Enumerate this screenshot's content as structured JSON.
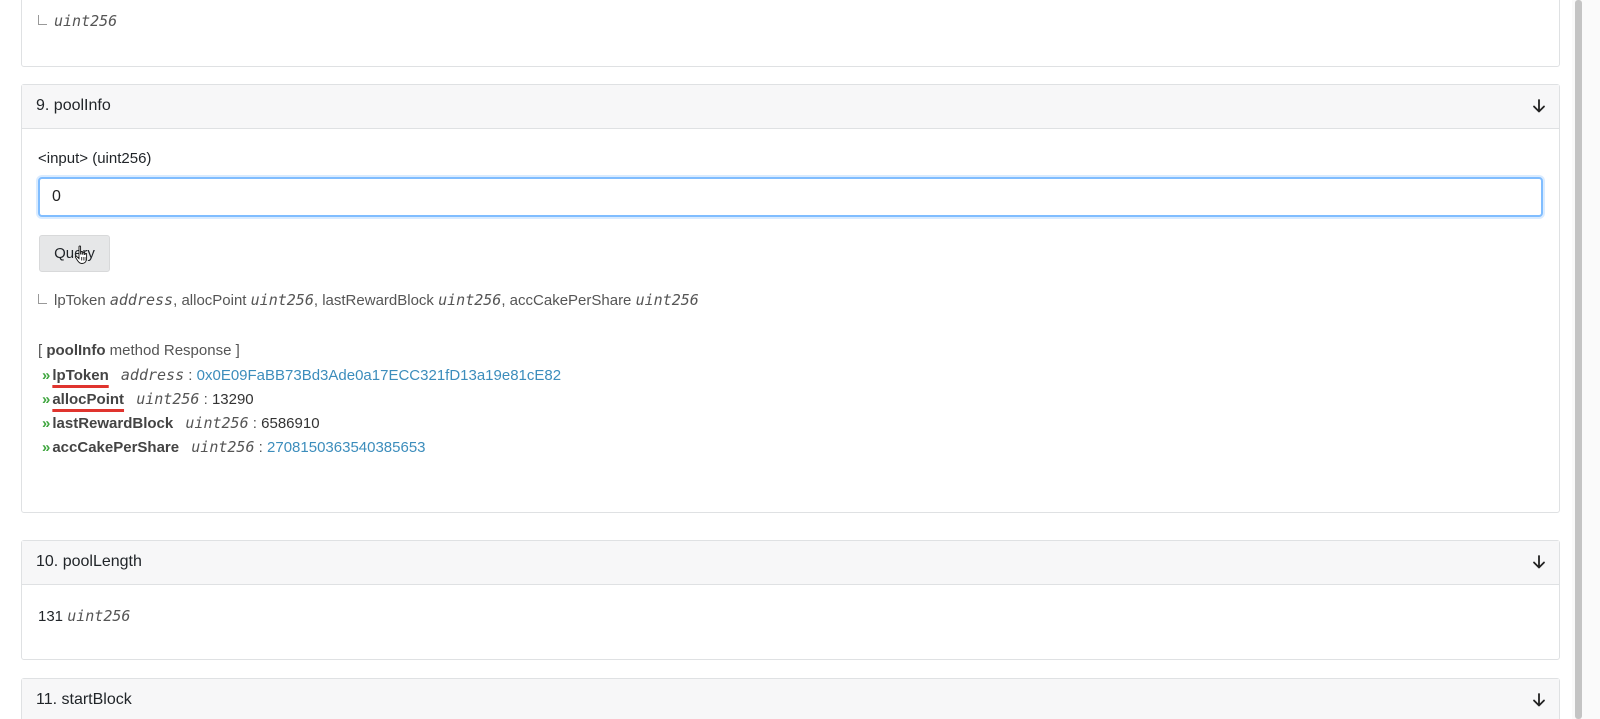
{
  "top_card": {
    "output_type": "uint256"
  },
  "pool_info": {
    "title": "9. poolInfo",
    "input_label": "<input> (uint256)",
    "input_value": "0",
    "query_label": "Query",
    "signature": {
      "parts": [
        {
          "name": "lpToken",
          "type": "address",
          "sep": ","
        },
        {
          "name": "allocPoint",
          "type": "uint256",
          "sep": ","
        },
        {
          "name": "lastRewardBlock",
          "type": "uint256",
          "sep": ","
        },
        {
          "name": "accCakePerShare",
          "type": "uint256",
          "sep": ""
        }
      ]
    },
    "response_header_open": "[",
    "response_method": "poolInfo",
    "response_header_text": "method Response ]",
    "arrow": "»",
    "colon": ":",
    "results": [
      {
        "name": "lpToken",
        "type": "address",
        "value": "0x0E09FaBB73Bd3Ade0a17ECC321fD13a19e81cE82"
      },
      {
        "name": "allocPoint",
        "type": "uint256",
        "value": "13290"
      },
      {
        "name": "lastRewardBlock",
        "type": "uint256",
        "value": "6586910"
      },
      {
        "name": "accCakePerShare",
        "type": "uint256",
        "value": "2708150363540385653"
      }
    ]
  },
  "pool_length": {
    "title": "10. poolLength",
    "value": "131",
    "type": "uint256"
  },
  "start_block": {
    "title": "11. startBlock"
  },
  "colors": {
    "link": "#3c8dbc",
    "arrow": "#3fa63f",
    "highlight_underline": "#e0342e",
    "input_focus": "#80bdff"
  }
}
